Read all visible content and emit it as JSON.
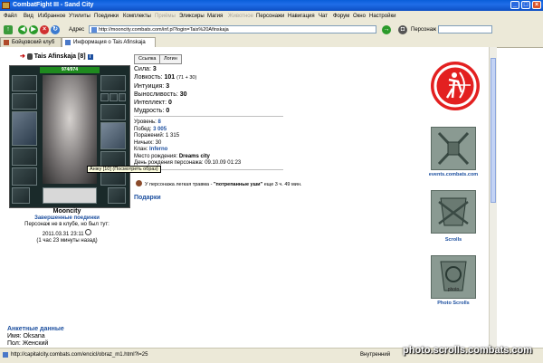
{
  "window": {
    "title": "CombatFight III - Sand City",
    "buttons": [
      "_",
      "□",
      "×"
    ]
  },
  "menu": {
    "items": [
      {
        "label": "Файл",
        "dim": false
      },
      {
        "label": "Вид",
        "dim": false
      },
      {
        "label": "Избранное",
        "dim": false
      },
      {
        "label": "Утилиты",
        "dim": false
      },
      {
        "label": "Поединки",
        "dim": false
      },
      {
        "label": "Комплекты",
        "dim": false
      },
      {
        "label": "Приёмы",
        "dim": true
      },
      {
        "label": "Эликсиры",
        "dim": false
      },
      {
        "label": "Магия",
        "dim": false
      },
      {
        "label": "Животное",
        "dim": true
      },
      {
        "label": "Персонажи",
        "dim": false
      },
      {
        "label": "Навигация",
        "dim": false
      },
      {
        "label": "Чат",
        "dim": false
      },
      {
        "label": "Форум",
        "dim": false
      },
      {
        "label": "Окно",
        "dim": false
      },
      {
        "label": "Настройки",
        "dim": false
      }
    ]
  },
  "toolbar": {
    "address_label": "Адрес",
    "address_value": "http://mooncity.combats.com/inf.pl?login=Tais%20Afinskaja",
    "person_label": "Персонаж"
  },
  "tabs": [
    {
      "label": "Бойцовский клуб",
      "active": false
    },
    {
      "label": "Информация о Tais Afinskaja",
      "active": true
    }
  ],
  "character": {
    "name": "Tais Afinskaja",
    "level": "[8]",
    "hp": "974/974",
    "buttons": {
      "link": "Ссылка",
      "login": "Логин"
    },
    "stats": [
      {
        "label": "Сила:",
        "value": "3",
        "extra": ""
      },
      {
        "label": "Ловкость:",
        "value": "101",
        "extra": "(71 + 30)"
      },
      {
        "label": "Интуиция:",
        "value": "3",
        "extra": ""
      },
      {
        "label": "Выносливость:",
        "value": "30",
        "extra": ""
      },
      {
        "label": "Интеллект:",
        "value": "0",
        "extra": ""
      },
      {
        "label": "Мудрость:",
        "value": "0",
        "extra": ""
      }
    ],
    "info": {
      "level_label": "Уровень:",
      "level_value": "8",
      "wins_label": "Побед:",
      "wins_value": "3 005",
      "losses_label": "Поражений:",
      "losses_value": "1 315",
      "draws_label": "Ничьих:",
      "draws_value": "30",
      "clan_label": "Клан:",
      "clan_value": "Inferno",
      "birthplace_label": "Место рождения:",
      "birthplace_value": "Dreams city",
      "birthday_label": "День рождения персонажа:",
      "birthday_value": "09.10.09 01:23"
    },
    "trauma_prefix": "У персонажа легкая травма - ",
    "trauma_name": "\"потрепанные уши\"",
    "trauma_suffix": " еще 3 ч. 49 мин.",
    "gifts": "Подарки",
    "tooltip": "Анжу [10] (Посмотреть образ)",
    "city": "Mooncity",
    "status_link": "Завершенные поединки",
    "status_text": "Персонаж не в клубе, но был тут:",
    "last_seen": "2011.03.31 23:11",
    "ago": "(1 час 23 минуты назад)"
  },
  "anketa": {
    "header": "Анкетные данные",
    "name_line": "Имя: Oksana",
    "gender_line": "Пол: Женский"
  },
  "sidebar": {
    "events_label": "events.combats.com",
    "scrolls_label": "Scrolls",
    "photo_label": "Photo Scrolls",
    "photo_word": "photo"
  },
  "status": {
    "url": "http://capitalcity.combats.com/encicl/obraz_m1.html?l=25",
    "zone": "Внутренний"
  },
  "watermark": "photo.scrolls.combats.com",
  "colors": {
    "titlebar": "#0a5ed9",
    "link": "#1c4f9f",
    "hp_green": "#1f8a1f",
    "archer_red": "#e32020"
  }
}
